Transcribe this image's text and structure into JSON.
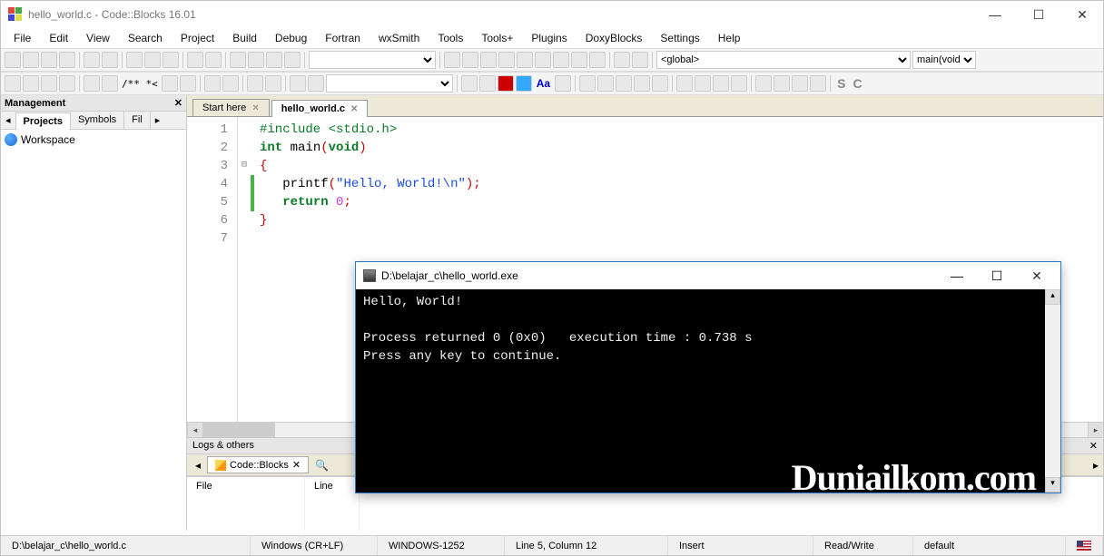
{
  "window": {
    "title": "hello_world.c - Code::Blocks 16.01"
  },
  "menu": [
    "File",
    "Edit",
    "View",
    "Search",
    "Project",
    "Build",
    "Debug",
    "Fortran",
    "wxSmith",
    "Tools",
    "Tools+",
    "Plugins",
    "DoxyBlocks",
    "Settings",
    "Help"
  ],
  "toolbar_low": {
    "regex": "/**  *<",
    "scope_selector": "<global>",
    "func_selector": "main(void)"
  },
  "mgmt": {
    "title": "Management",
    "tabs": [
      "Projects",
      "Symbols",
      "Fil"
    ],
    "workspace": "Workspace"
  },
  "editor_tabs": {
    "start": "Start here",
    "file": "hello_world.c"
  },
  "code": {
    "lines": [
      "1",
      "2",
      "3",
      "4",
      "5",
      "6",
      "7"
    ],
    "l1_pp": "#include ",
    "l1_inc": "<stdio.h>",
    "l2_kw1": "int",
    "l2_fn": " main",
    "l2_kw2": "void",
    "l4_fn": "printf",
    "l4_str": "\"Hello, World!\\n\"",
    "l5_kw": "return",
    "l5_num": "0"
  },
  "logs": {
    "title": "Logs & others",
    "tab": "Code::Blocks",
    "col_file": "File",
    "col_line": "Line"
  },
  "console": {
    "title": "D:\\belajar_c\\hello_world.exe",
    "line1": "Hello, World!",
    "line2": "",
    "line3": "Process returned 0 (0x0)   execution time : 0.738 s",
    "line4": "Press any key to continue.",
    "watermark": "Duniailkom.com"
  },
  "status": {
    "path": "D:\\belajar_c\\hello_world.c",
    "eol": "Windows (CR+LF)",
    "enc": "WINDOWS-1252",
    "pos": "Line 5, Column 12",
    "mode": "Insert",
    "rw": "Read/Write",
    "profile": "default"
  }
}
